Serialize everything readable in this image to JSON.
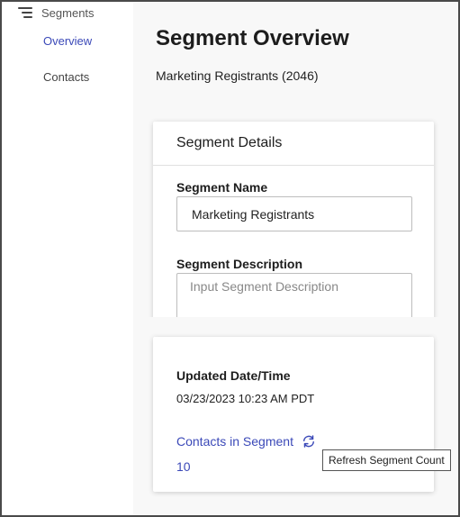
{
  "sidebar": {
    "title": "Segments",
    "items": [
      {
        "label": "Overview",
        "active": true
      },
      {
        "label": "Contacts",
        "active": false
      }
    ]
  },
  "main": {
    "title": "Segment Overview",
    "subtitle": "Marketing Registrants (2046)"
  },
  "details_card": {
    "header": "Segment Details",
    "name_label": "Segment Name",
    "name_value": "Marketing Registrants",
    "description_label": "Segment Description",
    "description_placeholder": "Input Segment Description"
  },
  "stats_card": {
    "updated_label": "Updated Date/Time",
    "updated_value": "03/23/2023 10:23 AM PDT",
    "contacts_label": "Contacts in Segment",
    "contacts_count": "10"
  },
  "tooltip": {
    "text": "Refresh Segment Count"
  },
  "colors": {
    "accent": "#3b49b8",
    "main_background": "#f8f8f8"
  },
  "icons": {
    "menu": "hamburger-icon",
    "refresh": "refresh-icon"
  }
}
